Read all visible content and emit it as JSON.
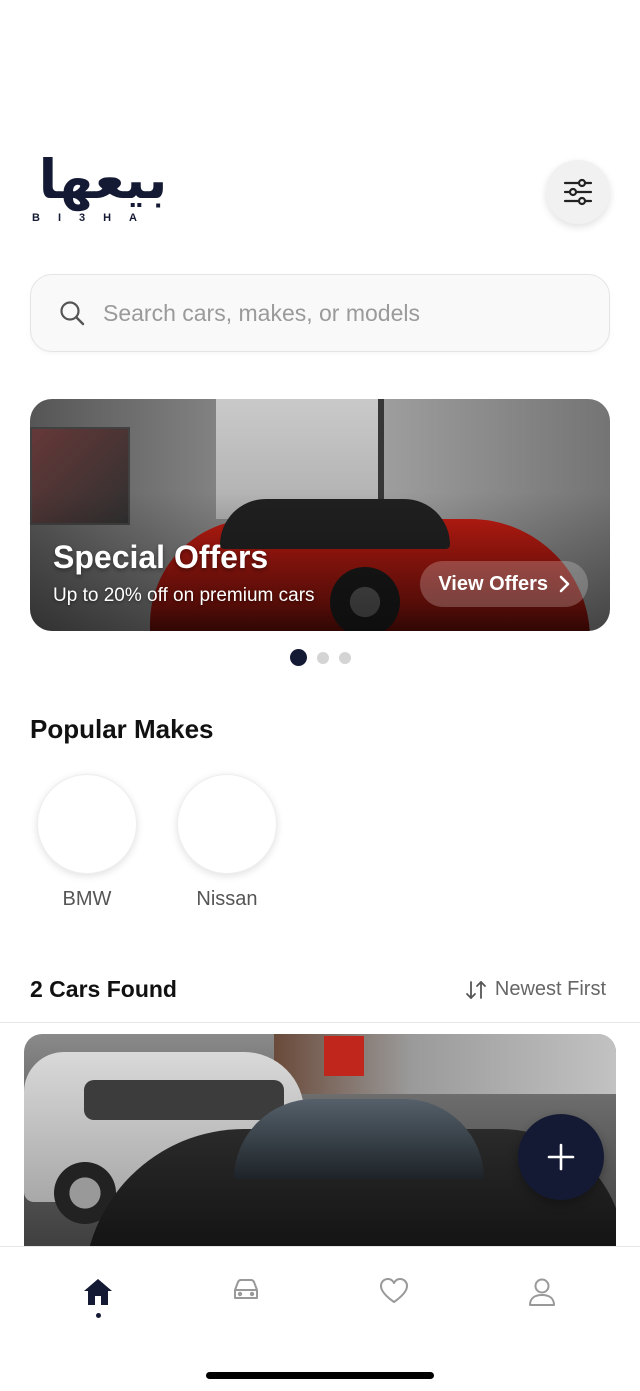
{
  "header": {
    "logo_arabic": "بيعها",
    "logo_latin": "BI3HA",
    "filter_icon": "sliders-icon"
  },
  "search": {
    "placeholder": "Search cars, makes, or models",
    "icon": "search-icon"
  },
  "banner": {
    "title": "Special Offers",
    "subtitle": "Up to 20% off on premium cars",
    "button_label": "View Offers",
    "button_icon": "chevron-right-icon",
    "active_slide": 1,
    "slide_count": 3
  },
  "popular_makes": {
    "title": "Popular Makes",
    "items": [
      {
        "label": "BMW"
      },
      {
        "label": "Nissan"
      }
    ]
  },
  "results": {
    "count_label": "2 Cars Found",
    "sort_label": "Newest First",
    "sort_icon": "sort-icon"
  },
  "fab": {
    "icon": "plus-icon"
  },
  "tabbar": {
    "items": [
      {
        "icon": "home-icon",
        "active": true
      },
      {
        "icon": "car-icon",
        "active": false
      },
      {
        "icon": "heart-icon",
        "active": false
      },
      {
        "icon": "user-icon",
        "active": false
      }
    ]
  },
  "colors": {
    "brand": "#141a33",
    "muted_text": "#9a9a9a",
    "background": "#ffffff"
  }
}
